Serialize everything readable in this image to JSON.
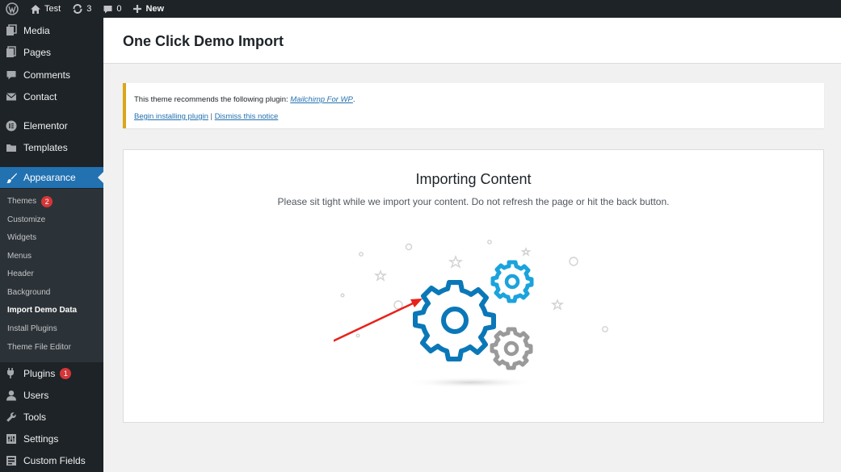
{
  "adminbar": {
    "site_name": "Test",
    "updates_count": "3",
    "comments_count": "0",
    "new_label": "New"
  },
  "sidebar": {
    "items": [
      {
        "label": "Media",
        "icon": "media-icon"
      },
      {
        "label": "Pages",
        "icon": "pages-icon"
      },
      {
        "label": "Comments",
        "icon": "comments-icon"
      },
      {
        "label": "Contact",
        "icon": "mail-icon"
      },
      {
        "label": "Elementor",
        "icon": "elementor-icon"
      },
      {
        "label": "Templates",
        "icon": "folder-icon"
      },
      {
        "label": "Appearance",
        "icon": "paintbrush-icon"
      },
      {
        "label": "Plugins",
        "icon": "plugin-icon",
        "badge": "1"
      },
      {
        "label": "Users",
        "icon": "user-icon"
      },
      {
        "label": "Tools",
        "icon": "wrench-icon"
      },
      {
        "label": "Settings",
        "icon": "settings-icon"
      },
      {
        "label": "Custom Fields",
        "icon": "custom-fields-icon"
      }
    ],
    "appearance_submenu": [
      {
        "label": "Themes",
        "badge": "2"
      },
      {
        "label": "Customize"
      },
      {
        "label": "Widgets"
      },
      {
        "label": "Menus"
      },
      {
        "label": "Header"
      },
      {
        "label": "Background"
      },
      {
        "label": "Import Demo Data"
      },
      {
        "label": "Install Plugins"
      },
      {
        "label": "Theme File Editor"
      }
    ],
    "active_color": "#2271b1"
  },
  "header": {
    "title": "One Click Demo Import"
  },
  "notice": {
    "text": "This theme recommends the following plugin:",
    "plugin_name": "Mailchimp For WP",
    "period": ".",
    "install_link": "Begin installing plugin",
    "separator": "|",
    "dismiss_link": "Dismiss this notice",
    "border_color": "#dba617"
  },
  "import": {
    "title": "Importing Content",
    "subtitle": "Please sit tight while we import your content. Do not refresh the page or hit the back button.",
    "gear_main_color": "#0a78b8",
    "gear_small_color": "#1ba3dd",
    "gear_grey_color": "#9a9a9a",
    "annotation_arrow_color": "#e8211a"
  }
}
